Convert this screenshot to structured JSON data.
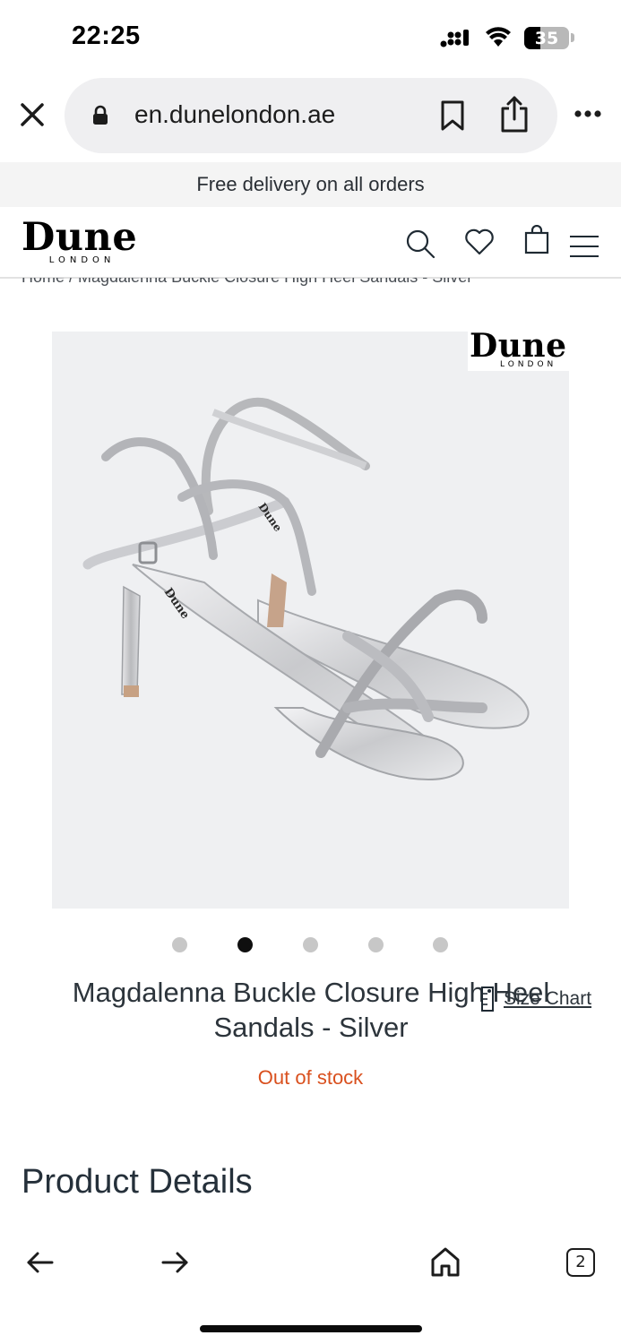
{
  "status_bar": {
    "time": "22:25",
    "battery_level": "35",
    "battery_fraction": 0.35,
    "icons": [
      "signal-icon",
      "wifi-icon",
      "battery-icon"
    ]
  },
  "browser": {
    "url": "en.dunelondon.ae",
    "icons": [
      "close-icon",
      "lock-icon",
      "bookmark-icon",
      "share-icon",
      "more-icon"
    ]
  },
  "promo": {
    "text": "Free delivery on all orders"
  },
  "header": {
    "logo_main": "Dune",
    "logo_sub": "LONDON",
    "icons": [
      "search-icon",
      "heart-icon",
      "bag-icon",
      "menu-icon"
    ]
  },
  "breadcrumb": {
    "text": "Home / Magdalenna Buckle Closure High Heel Sandals - Silver"
  },
  "gallery": {
    "badge_main": "Dune",
    "badge_sub": "LONDON",
    "image_count": 5,
    "active_index": 1
  },
  "product": {
    "title": "Magdalenna Buckle Closure High Heel Sandals - Silver",
    "size_chart_label": "Size Chart",
    "stock_status": "Out of stock",
    "stock_color": "#d9501e"
  },
  "details": {
    "heading": "Product Details"
  },
  "toolbar": {
    "tab_count": "2",
    "icons": [
      "back-arrow-icon",
      "forward-arrow-icon",
      "home-icon",
      "tabs-icon"
    ]
  }
}
